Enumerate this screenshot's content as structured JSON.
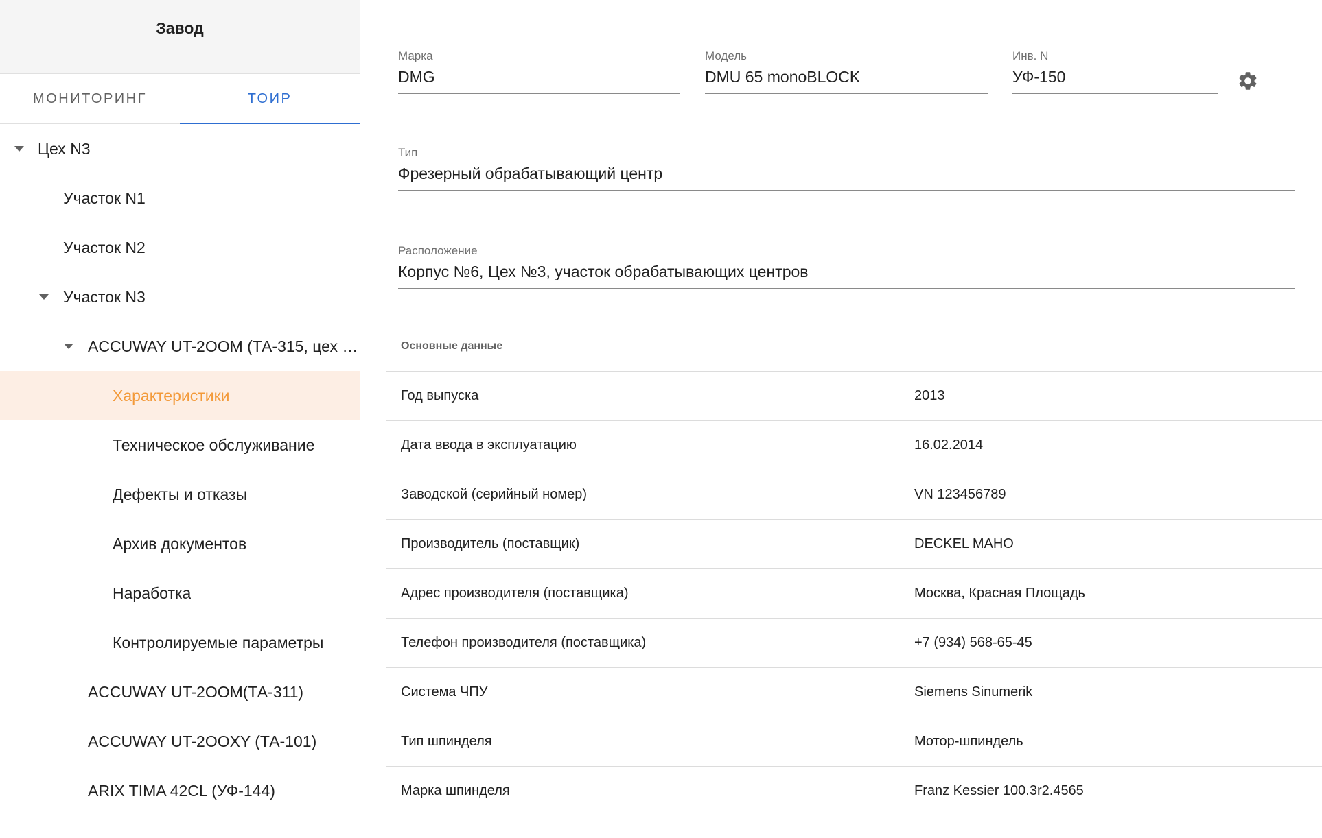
{
  "sidebar": {
    "title": "Завод",
    "tabs": [
      {
        "label": "Мониторинг",
        "active": false
      },
      {
        "label": "ТОиР",
        "active": true
      }
    ],
    "tree": [
      {
        "label": "Цех N3",
        "expanded": true,
        "selected": false
      },
      {
        "label": "Участок N1",
        "expanded": false,
        "selected": false
      },
      {
        "label": "Участок N2",
        "expanded": false,
        "selected": false
      },
      {
        "label": "Участок N3",
        "expanded": true,
        "selected": false
      },
      {
        "label": "ACCUWAY UT-2OOM (ТА-315, цех …",
        "expanded": true,
        "selected": false
      },
      {
        "label": "Характеристики",
        "expanded": false,
        "selected": true
      },
      {
        "label": "Техническое обслуживание",
        "expanded": false,
        "selected": false
      },
      {
        "label": "Дефекты и отказы",
        "expanded": false,
        "selected": false
      },
      {
        "label": "Архив документов",
        "expanded": false,
        "selected": false
      },
      {
        "label": "Наработка",
        "expanded": false,
        "selected": false
      },
      {
        "label": "Контролируемые параметры",
        "expanded": false,
        "selected": false
      },
      {
        "label": "ACCUWAY UT-2OOM(ТА-311)",
        "expanded": false,
        "selected": false
      },
      {
        "label": "ACCUWAY UT-2OOXY (ТА-101)",
        "expanded": false,
        "selected": false
      },
      {
        "label": "ARIX TIMA 42CL (УФ-144)",
        "expanded": false,
        "selected": false
      }
    ]
  },
  "main": {
    "brand": {
      "label": "Марка",
      "value": "DMG"
    },
    "model": {
      "label": "Модель",
      "value": "DMU 65 monoBLOCK"
    },
    "inventory": {
      "label": "Инв. N",
      "value": "УФ-150"
    },
    "type": {
      "label": "Тип",
      "value": "Фрезерный обрабатывающий центр"
    },
    "location": {
      "label": "Расположение",
      "value": "Корпус №6, Цех №3, участок обрабатывающих центров"
    },
    "settings_icon": "gear-icon",
    "section_title": "Основные данные",
    "properties": [
      {
        "name": "Год выпуска",
        "value": "2013"
      },
      {
        "name": "Дата ввода в эксплуатацию",
        "value": "16.02.2014"
      },
      {
        "name": "Заводской (серийный номер)",
        "value": "VN 123456789"
      },
      {
        "name": "Производитель (поставщик)",
        "value": "DECKEL MAHO"
      },
      {
        "name": "Адрес производителя (поставщика)",
        "value": "Москва, Красная Площадь"
      },
      {
        "name": "Телефон производителя (поставщика)",
        "value": "+7 (934) 568-65-45"
      },
      {
        "name": "Система ЧПУ",
        "value": "Siemens Sinumerik"
      },
      {
        "name": "Тип шпинделя",
        "value": "Мотор-шпиндель"
      },
      {
        "name": "Марка шпинделя",
        "value": "Franz Kessier 100.3r2.4565"
      }
    ]
  },
  "colors": {
    "accent": "#2e6ed1",
    "selected_bg": "#fdeee4",
    "selected_text": "#f39a3a"
  }
}
